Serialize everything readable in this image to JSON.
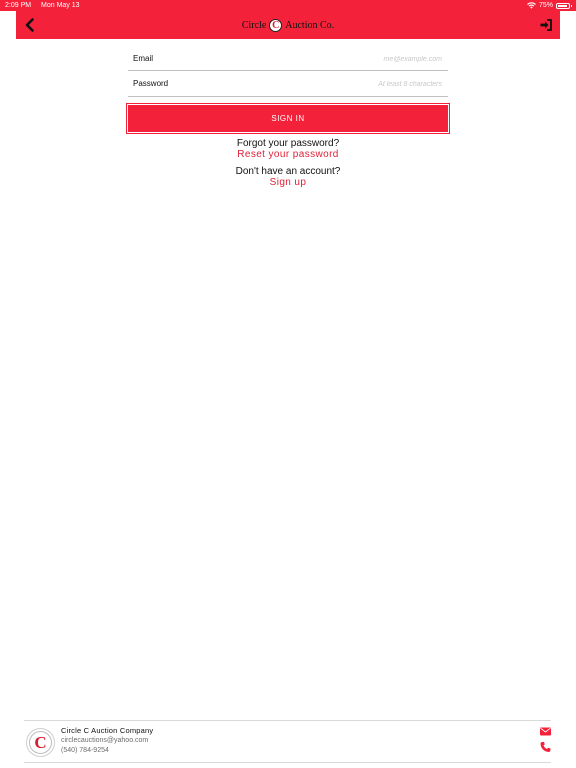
{
  "status_bar": {
    "time": "2:09 PM",
    "date": "Mon May 13",
    "battery": "75%",
    "battery_level": 0.75
  },
  "navbar": {
    "title_left": "Circle",
    "title_mark": "C",
    "title_right": "Auction Co.",
    "back_icon": "chevron-left-icon",
    "signin_icon": "sign-in-icon"
  },
  "form": {
    "email_label": "Email",
    "email_placeholder": "me@example.com",
    "email_value": "",
    "password_label": "Password",
    "password_placeholder": "At least 8 characters",
    "password_value": "",
    "signin_label": "SIGN IN"
  },
  "help": {
    "forgot_question": "Forgot your password?",
    "reset_link": "Reset your password",
    "account_question": "Don't have an account?",
    "signup_link": "Sign up"
  },
  "footer": {
    "logo_letter": "C",
    "company_name": "Circle C Auction Company",
    "email": "circlecauctions@yahoo.com",
    "phone": "(540) 784-9254",
    "mail_icon": "envelope-icon",
    "phone_icon": "phone-icon"
  },
  "colors": {
    "brand_red": "#f3223a",
    "link_red": "#e01e35"
  }
}
